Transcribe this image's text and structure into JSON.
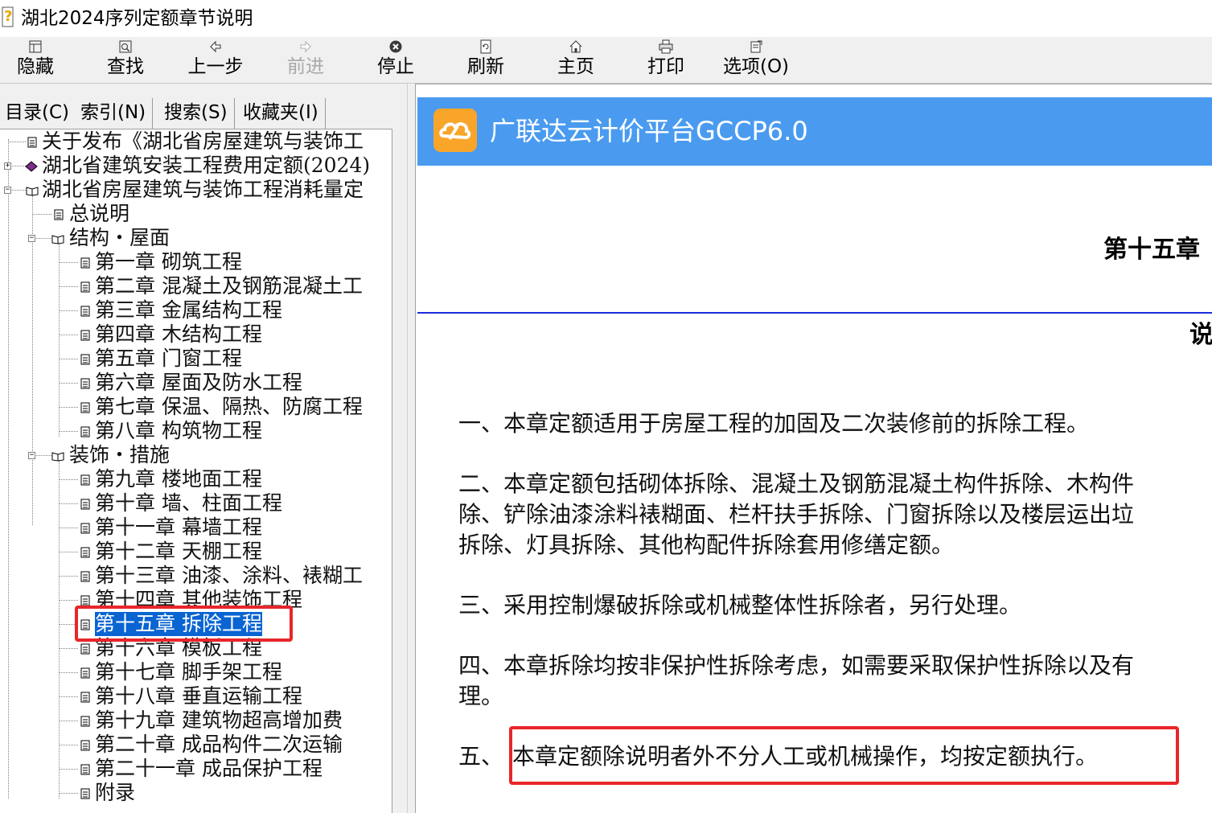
{
  "window": {
    "title": "湖北2024序列定额章节说明",
    "icon": "help-file-icon"
  },
  "toolbar": {
    "hide": "隐藏",
    "find": "查找",
    "back": "上一步",
    "forward": "前进",
    "stop": "停止",
    "refresh": "刷新",
    "home": "主页",
    "print": "打印",
    "options": "选项(O)"
  },
  "tabs": {
    "contents": "目录(C)",
    "index": "索引(N)",
    "search": "搜索(S)",
    "favorites": "收藏夹(I)"
  },
  "tree": {
    "items": [
      "关于发布《湖北省房屋建筑与装饰工",
      "湖北省建筑安装工程费用定额(2024)",
      "湖北省房屋建筑与装饰工程消耗量定",
      "总说明",
      "结构・屋面",
      "第一章  砌筑工程",
      "第二章  混凝土及钢筋混凝土工",
      "第三章  金属结构工程",
      "第四章  木结构工程",
      "第五章  门窗工程",
      "第六章  屋面及防水工程",
      "第七章  保温、隔热、防腐工程",
      "第八章  构筑物工程",
      "装饰・措施",
      "第九章  楼地面工程",
      "第十章  墙、柱面工程",
      "第十一章  幕墙工程",
      "第十二章  天棚工程",
      "第十三章  油漆、涂料、裱糊工",
      "第十四章  其他装饰工程",
      "第十五章  拆除工程",
      "第十六章  模板工程",
      "第十七章  脚手架工程",
      "第十八章  垂直运输工程",
      "第十九章  建筑物超高增加费",
      "第二十章  成品构件二次运输",
      "第二十一章  成品保护工程",
      "附录"
    ],
    "selected": "第十五章  拆除工程"
  },
  "content": {
    "banner": "广联达云计价平台GCCP6.0",
    "chapter_title": "第十五章",
    "section_title": "说",
    "paragraphs": [
      "一、本章定额适用于房屋工程的加固及二次装修前的拆除工程。",
      "二、本章定额包括砌体拆除、混凝土及钢筋混凝土构件拆除、木构件",
      "除、铲除油漆涂料裱糊面、栏杆扶手拆除、门窗拆除以及楼层运出垃",
      "拆除、灯具拆除、其他构配件拆除套用修缮定额。",
      "三、采用控制爆破拆除或机械整体性拆除者，另行处理。",
      "四、本章拆除均按非保护性拆除考虑，如需要采取保护性拆除以及有",
      "理。",
      "五、",
      "本章定额除说明者外不分人工或机械操作，均按定额执行。"
    ]
  },
  "colors": {
    "banner": "#4a9bf0",
    "logo": "#f8a52a",
    "selection": "#0a64d2",
    "highlight": "#e8262a",
    "rule": "#1c2bd9"
  }
}
